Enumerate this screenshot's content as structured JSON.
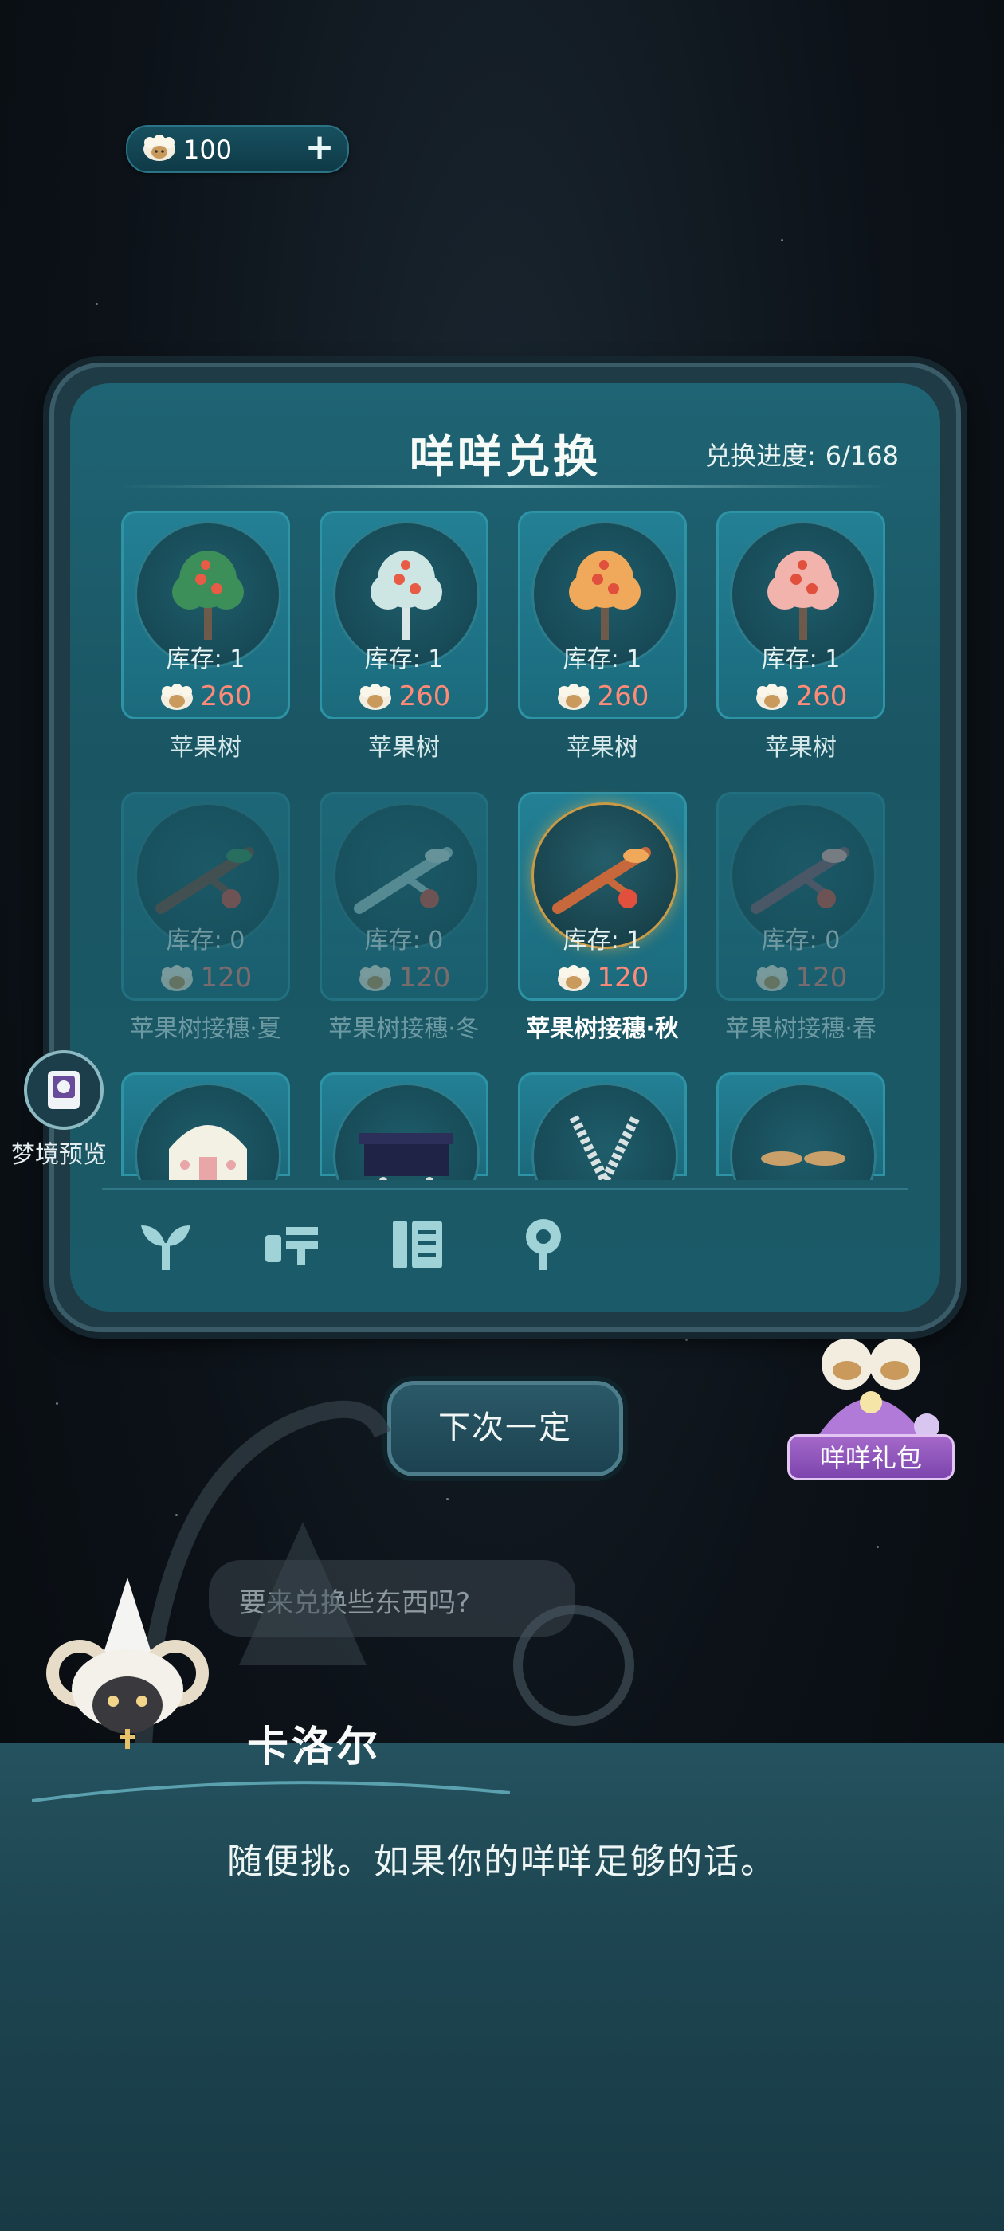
{
  "currency": {
    "amount": "100",
    "plus_label": "+"
  },
  "panel": {
    "title": "咩咩兑换",
    "progress_label": "兑换进度:",
    "progress_value": "6/168"
  },
  "items": [
    {
      "stock": "库存: 1",
      "price": "260",
      "name": "苹果树",
      "icon": "apple-tree-green-icon"
    },
    {
      "stock": "库存: 1",
      "price": "260",
      "name": "苹果树",
      "icon": "apple-tree-white-icon"
    },
    {
      "stock": "库存: 1",
      "price": "260",
      "name": "苹果树",
      "icon": "apple-tree-orange-icon"
    },
    {
      "stock": "库存: 1",
      "price": "260",
      "name": "苹果树",
      "icon": "apple-tree-pink-icon"
    },
    {
      "stock": "库存: 0",
      "price": "120",
      "name": "苹果树接穗·夏",
      "icon": "apple-scion-summer-icon"
    },
    {
      "stock": "库存: 0",
      "price": "120",
      "name": "苹果树接穗·冬",
      "icon": "apple-scion-winter-icon"
    },
    {
      "stock": "库存: 1",
      "price": "120",
      "name": "苹果树接穗·秋",
      "icon": "apple-scion-autumn-icon"
    },
    {
      "stock": "库存: 0",
      "price": "120",
      "name": "苹果树接穗·春",
      "icon": "apple-scion-spring-icon"
    }
  ],
  "tabs": [
    "plant-tab-icon",
    "furniture-tab-icon",
    "book-tab-icon",
    "decor-tab-icon"
  ],
  "side": {
    "preview_label": "梦境预览"
  },
  "buttons": {
    "next_time": "下次一定"
  },
  "gift": {
    "label": "咩咩礼包"
  },
  "bubble": {
    "text": "要来兑换些东西吗?"
  },
  "dialog": {
    "npc_name": "卡洛尔",
    "text": "随便挑。如果你的咩咩足够的话。"
  },
  "colors": {
    "price": "#ff8a78",
    "panel": "#1f6474",
    "dialog": "#1d4551"
  }
}
